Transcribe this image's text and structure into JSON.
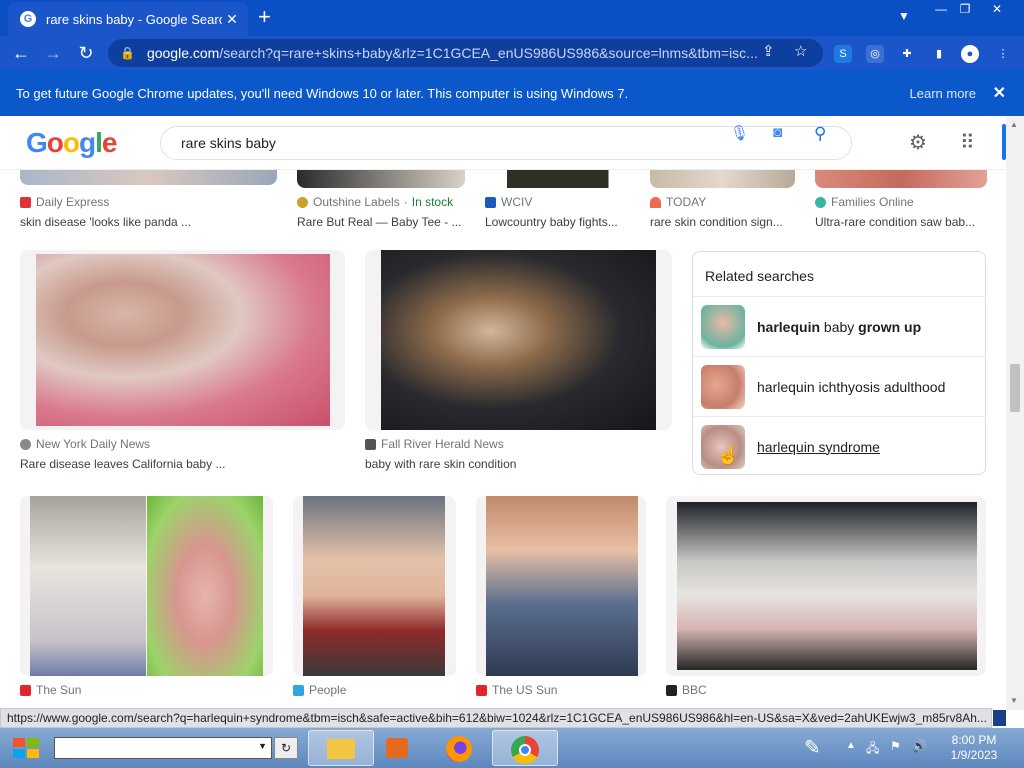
{
  "browser": {
    "tab_title": "rare skins baby - Google Search",
    "tab_close": "✕",
    "new_tab": "+",
    "url_host": "google.com",
    "url_rest": "/search?q=rare+skins+baby&rlz=1C1GCEA_enUS986US986&source=lnms&tbm=isc...",
    "window_controls": {
      "minimize": "—",
      "restore": "❐",
      "close": "✕"
    }
  },
  "infobar": {
    "message": "To get future Google Chrome updates, you'll need Windows 10 or later. This computer is using Windows 7.",
    "learn_more": "Learn more",
    "close": "✕"
  },
  "google": {
    "logo": "Google",
    "query": "rare skins baby"
  },
  "top_row": [
    {
      "source": "Daily Express",
      "caption": "skin disease 'looks like panda ..."
    },
    {
      "source": "Outshine Labels",
      "stock": "In stock",
      "caption": "Rare But Real — Baby Tee - ..."
    },
    {
      "source": "WCIV",
      "caption": "Lowcountry baby fights..."
    },
    {
      "source": "TODAY",
      "caption": "rare skin condition sign..."
    },
    {
      "source": "Families Online",
      "caption": "Ultra-rare condition saw bab..."
    }
  ],
  "middle_row": [
    {
      "source": "New York Daily News",
      "caption": "Rare disease leaves California baby ..."
    },
    {
      "source": "Fall River Herald News",
      "caption": "baby with rare skin condition"
    }
  ],
  "related": {
    "title": "Related searches",
    "items": [
      {
        "bold1": "harlequin",
        "plain": " baby ",
        "bold2": "grown up"
      },
      {
        "bold1": "",
        "plain": "harlequin ichthyosis adulthood",
        "bold2": ""
      },
      {
        "bold1": "",
        "plain": "harlequin syndrome",
        "bold2": ""
      }
    ]
  },
  "bottom_row": [
    {
      "source": "The Sun"
    },
    {
      "source": "People"
    },
    {
      "source": "The US Sun"
    },
    {
      "source": "BBC"
    }
  ],
  "status_url": "https://www.google.com/search?q=harlequin+syndrome&tbm=isch&safe=active&bih=612&biw=1024&rlz=1C1GCEA_enUS986US986&hl=en-US&sa=X&ved=2ahUKEwjw3_m85rv8Ah...",
  "taskbar": {
    "time": "8:00 PM",
    "date": "1/9/2023",
    "refresh": "↻"
  },
  "colors": {
    "chrome_blue": "#1a56c9",
    "google_blue": "#4285f4",
    "google_red": "#ea4335",
    "google_yellow": "#fbbc05",
    "google_green": "#34a853"
  }
}
